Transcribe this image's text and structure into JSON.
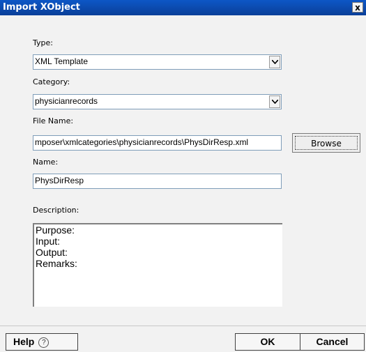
{
  "window": {
    "title": "Import XObject",
    "close_label": "x"
  },
  "form": {
    "type": {
      "label": "Type:",
      "value": "XML Template"
    },
    "category": {
      "label": "Category:",
      "value": "physicianrecords"
    },
    "file": {
      "label": "File Name:",
      "value": "mposer\\xmlcategories\\physicianrecords\\PhysDirResp.xml",
      "browse_label": "Browse"
    },
    "name": {
      "label": "Name:",
      "value": "PhysDirResp"
    },
    "description": {
      "label": "Description:",
      "lines": [
        "Purpose:",
        "Input:",
        "Output:",
        "Remarks:"
      ]
    }
  },
  "buttons": {
    "help": "Help",
    "help_icon": "?",
    "ok": "OK",
    "cancel": "Cancel"
  }
}
